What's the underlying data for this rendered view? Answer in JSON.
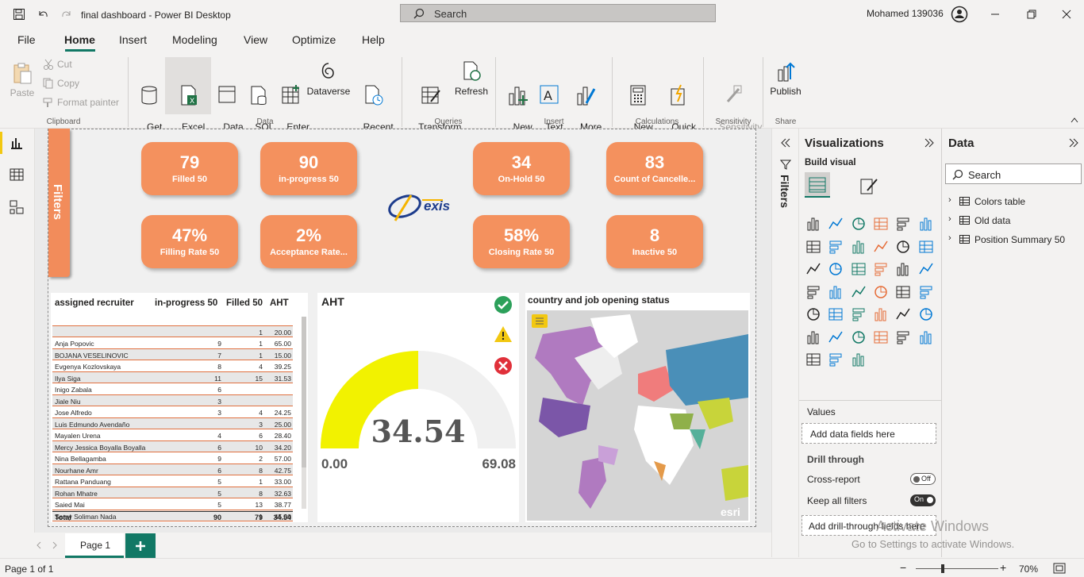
{
  "window": {
    "title": "final dashboard - Power BI Desktop",
    "search_placeholder": "Search",
    "user": "Mohamed 139036"
  },
  "menu": [
    "File",
    "Home",
    "Insert",
    "Modeling",
    "View",
    "Optimize",
    "Help"
  ],
  "ribbon": {
    "clipboard": {
      "paste": "Paste",
      "cut": "Cut",
      "copy": "Copy",
      "format_painter": "Format painter",
      "group": "Clipboard"
    },
    "data": {
      "get_data": "Get\ndata ˅",
      "excel": "Excel\nworkbook",
      "data_hub": "Data\nhub ˅",
      "sql": "SQL\nServer",
      "enter_data": "Enter\ndata",
      "dataverse": "Dataverse",
      "recent": "Recent\nsources ˅",
      "group": "Data"
    },
    "queries": {
      "transform": "Transform\ndata ˅",
      "refresh": "Refresh",
      "group": "Queries"
    },
    "insert": {
      "new_visual": "New\nvisual",
      "text_box": "Text\nbox",
      "more_visuals": "More\nvisuals ˅",
      "group": "Insert"
    },
    "calculations": {
      "new_measure": "New\nmeasure",
      "quick_measure": "Quick\nmeasure",
      "group": "Calculations"
    },
    "sensitivity": {
      "label": "Sensitivity\n˅",
      "group": "Sensitivity"
    },
    "share": {
      "publish": "Publish",
      "group": "Share"
    }
  },
  "filters_tab": "Filters",
  "kpis": [
    {
      "value": "79",
      "label": "Filled 50"
    },
    {
      "value": "90",
      "label": "in-progress 50"
    },
    {
      "value": "34",
      "label": "On-Hold 50"
    },
    {
      "value": "83",
      "label": "Count of Cancelle..."
    },
    {
      "value": "47%",
      "label": "Filling Rate 50"
    },
    {
      "value": "2%",
      "label": "Acceptance Rate..."
    },
    {
      "value": "58%",
      "label": "Closing Rate 50"
    },
    {
      "value": "8",
      "label": "Inactive 50"
    }
  ],
  "logo_text": "exis",
  "table": {
    "headers": [
      "assigned recruiter",
      "in-progress 50",
      "Filled 50",
      "AHT"
    ],
    "rows": [
      [
        "",
        "",
        "",
        ""
      ],
      [
        "",
        "",
        "1",
        "20.00"
      ],
      [
        "Anja Popovic",
        "9",
        "1",
        "65.00"
      ],
      [
        "BOJANA VESELINOVIC",
        "7",
        "1",
        "15.00"
      ],
      [
        "Evgenya Kozlovskaya",
        "8",
        "4",
        "39.25"
      ],
      [
        "Ilya Siga",
        "11",
        "15",
        "31.53"
      ],
      [
        "Inigo Zabala",
        "6",
        "",
        ""
      ],
      [
        "Jiale Niu",
        "3",
        "",
        ""
      ],
      [
        "Jose Alfredo",
        "3",
        "4",
        "24.25"
      ],
      [
        "Luis Edmundo Avendaño",
        "",
        "3",
        "25.00"
      ],
      [
        "Mayalen Urena",
        "4",
        "6",
        "28.40"
      ],
      [
        "Mercy Jessica Boyalla Boyalla",
        "6",
        "10",
        "34.20"
      ],
      [
        "Nina Bellagamba",
        "9",
        "2",
        "57.00"
      ],
      [
        "Nourhane Amr",
        "6",
        "8",
        "42.75"
      ],
      [
        "Rattana Panduang",
        "5",
        "1",
        "33.00"
      ],
      [
        "Rohan Mhatre",
        "5",
        "8",
        "32.63"
      ],
      [
        "Saied Mai",
        "5",
        "13",
        "38.77"
      ],
      [
        "Samy Soliman Nada",
        "",
        "1",
        "45.00"
      ]
    ],
    "total": [
      "Total",
      "90",
      "79",
      "34.54"
    ]
  },
  "gauge": {
    "title": "AHT",
    "value": "34.54",
    "min": "0.00",
    "max": "69.08",
    "fill_fraction": 0.5,
    "color": "#f2f200"
  },
  "map": {
    "title": "country and job opening status",
    "attribution": "esri"
  },
  "visualizations": {
    "title": "Visualizations",
    "build_visual": "Build visual",
    "values": "Values",
    "add_fields": "Add data fields here",
    "drill_through": "Drill through",
    "cross_report": "Cross-report",
    "cross_report_state": "Off",
    "keep_filters": "Keep all filters",
    "keep_filters_state": "On",
    "add_drill": "Add drill-through fields here",
    "filters_label": "Filters"
  },
  "data_pane": {
    "title": "Data",
    "search_placeholder": "Search",
    "tables": [
      "Colors table",
      "Old data",
      "Position Summary 50"
    ]
  },
  "pages": {
    "current": "Page 1",
    "status": "Page 1 of 1",
    "zoom": "70%"
  },
  "watermark": {
    "line1": "Activate Windows",
    "line2": "Go to Settings to activate Windows."
  },
  "colors": {
    "kpi": "#f4915e",
    "accent": "#117865",
    "gauge_fill": "#f2f200"
  }
}
